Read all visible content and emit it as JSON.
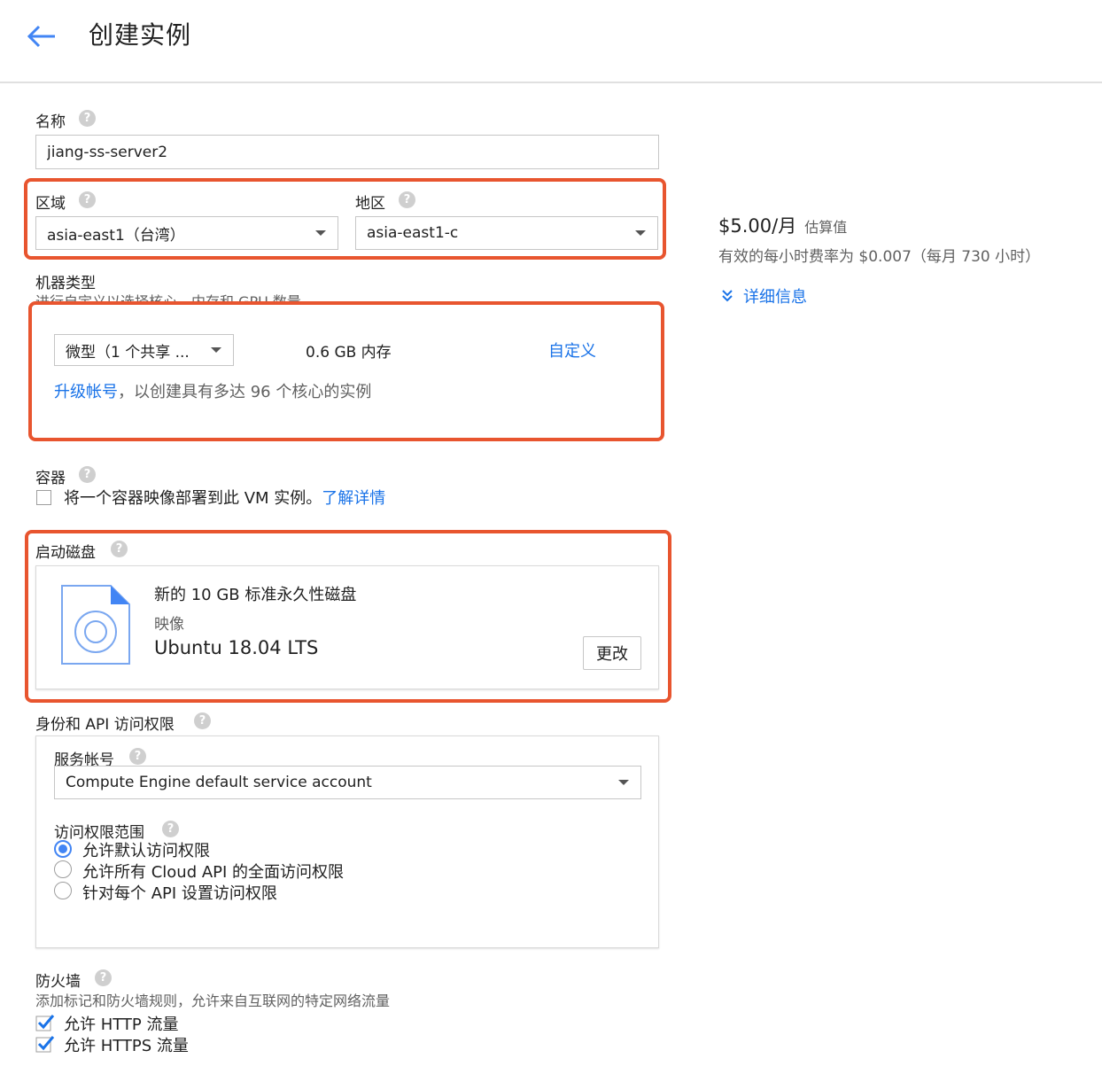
{
  "header": {
    "title": "创建实例"
  },
  "name_field": {
    "label": "名称",
    "value": "jiang-ss-server2"
  },
  "region": {
    "label": "区域",
    "value": "asia-east1（台湾）"
  },
  "zone": {
    "label": "地区",
    "value": "asia-east1-c"
  },
  "pricing": {
    "price": "$5.00/月",
    "estimate_label": "估算值",
    "hourly": "有效的每小时费率为 $0.007（每月 730 小时）",
    "details_link": "详细信息"
  },
  "machine": {
    "label": "机器类型",
    "description": "进行自定义以选择核心、内存和 GPU 数量。",
    "type_value": "微型（1 个共享 ...",
    "memory": "0.6 GB 内存",
    "customize_link": "自定义",
    "upgrade_link": "升级帐号",
    "upgrade_text": "，以创建具有多达 96 个核心的实例"
  },
  "container": {
    "label": "容器",
    "checkbox_text": "将一个容器映像部署到此 VM 实例。",
    "learn_more": "了解详情"
  },
  "boot_disk": {
    "label": "启动磁盘",
    "disk_title": "新的 10 GB 标准永久性磁盘",
    "image_label": "映像",
    "image_value": "Ubuntu 18.04 LTS",
    "change_button": "更改"
  },
  "identity": {
    "label": "身份和 API 访问权限",
    "service_account_label": "服务帐号",
    "service_account_value": "Compute Engine default service account",
    "scopes_label": "访问权限范围",
    "scopes": [
      {
        "label": "允许默认访问权限",
        "selected": true
      },
      {
        "label": "允许所有 Cloud API 的全面访问权限",
        "selected": false
      },
      {
        "label": "针对每个 API 设置访问权限",
        "selected": false
      }
    ]
  },
  "firewall": {
    "label": "防火墙",
    "description": "添加标记和防火墙规则，允许来自互联网的特定网络流量",
    "options": [
      {
        "label": "允许 HTTP 流量",
        "checked": true
      },
      {
        "label": "允许 HTTPS 流量",
        "checked": true
      }
    ]
  },
  "icons": {
    "help": "?"
  },
  "colors": {
    "accent": "#1a73e8",
    "highlight": "#e8552f",
    "radio": "#4285f4"
  }
}
